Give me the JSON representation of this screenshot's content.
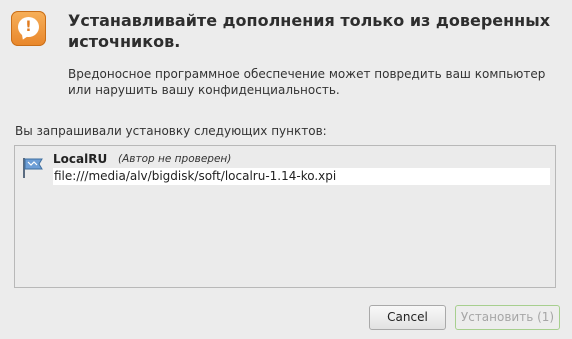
{
  "dialog": {
    "title": "Устанавливайте дополнения только из доверенных источников.",
    "message": "Вредоносное программное обеспечение может повредить ваш компьютер или нарушить вашу конфиденциальность.",
    "list_caption": "Вы запрашивали установку следующих пунктов:",
    "icon": "warning-speech-bubble-icon",
    "accent_color": "#e8862a"
  },
  "addons": [
    {
      "name": "LocalRU",
      "author_note": "(Автор не проверен)",
      "url": "file:///media/alv/bigdisk/soft/localru-1.14-ko.xpi",
      "icon": "puzzle-flag-icon"
    }
  ],
  "buttons": {
    "cancel_label": "Cancel",
    "install_label": "Установить (1)",
    "install_border_color": "#a7cf8f"
  }
}
